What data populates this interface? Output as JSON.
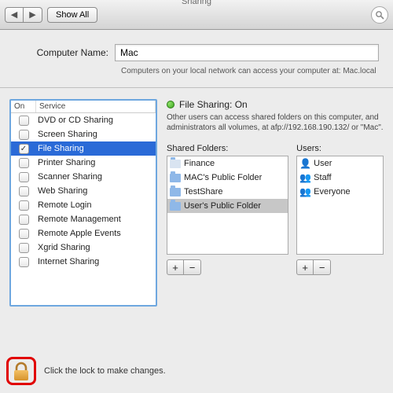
{
  "window": {
    "title": "Sharing"
  },
  "toolbar": {
    "show_all": "Show All"
  },
  "computer_name": {
    "label": "Computer Name:",
    "value": "Mac",
    "hint": "Computers on your local network can access your computer at: Mac.local"
  },
  "services": {
    "header_on": "On",
    "header_service": "Service",
    "items": [
      {
        "label": "DVD or CD Sharing",
        "checked": false,
        "selected": false
      },
      {
        "label": "Screen Sharing",
        "checked": false,
        "selected": false
      },
      {
        "label": "File Sharing",
        "checked": true,
        "selected": true
      },
      {
        "label": "Printer Sharing",
        "checked": false,
        "selected": false
      },
      {
        "label": "Scanner Sharing",
        "checked": false,
        "selected": false
      },
      {
        "label": "Web Sharing",
        "checked": false,
        "selected": false
      },
      {
        "label": "Remote Login",
        "checked": false,
        "selected": false
      },
      {
        "label": "Remote Management",
        "checked": false,
        "selected": false
      },
      {
        "label": "Remote Apple Events",
        "checked": false,
        "selected": false
      },
      {
        "label": "Xgrid Sharing",
        "checked": false,
        "selected": false
      },
      {
        "label": "Internet Sharing",
        "checked": false,
        "selected": false
      }
    ]
  },
  "status": {
    "title": "File Sharing: On",
    "desc": "Other users can access shared folders on this computer, and administrators all volumes, at afp://192.168.190.132/ or \"Mac\"."
  },
  "shared": {
    "label": "Shared Folders:",
    "items": [
      {
        "label": "Finance",
        "selected": false,
        "icon": "img"
      },
      {
        "label": "MAC's Public Folder",
        "selected": false,
        "icon": "folder"
      },
      {
        "label": "TestShare",
        "selected": false,
        "icon": "folder"
      },
      {
        "label": "User's Public Folder",
        "selected": true,
        "icon": "folder"
      }
    ]
  },
  "users": {
    "label": "Users:",
    "items": [
      {
        "label": "User",
        "icon": "👤"
      },
      {
        "label": "Staff",
        "icon": "👥"
      },
      {
        "label": "Everyone",
        "icon": "👥"
      }
    ]
  },
  "buttons": {
    "plus": "+",
    "minus": "−"
  },
  "lock": {
    "text": "Click the lock to make changes."
  }
}
